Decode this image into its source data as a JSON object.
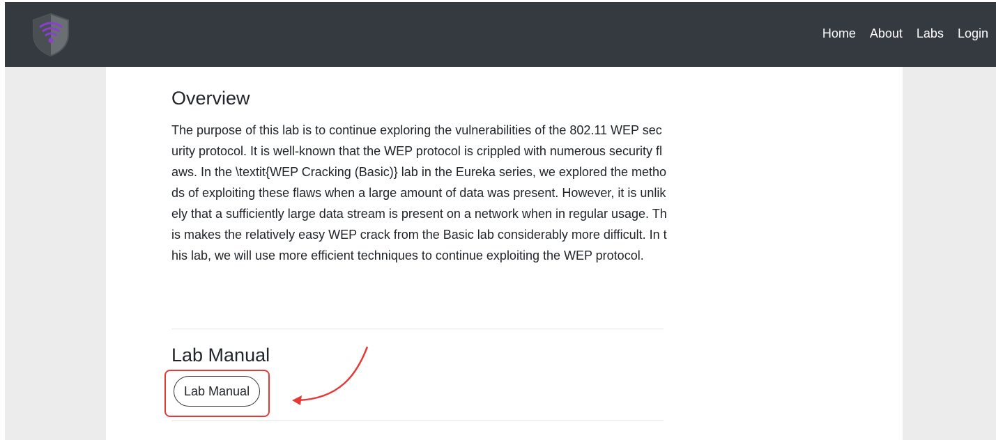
{
  "navbar": {
    "links": [
      {
        "label": "Home"
      },
      {
        "label": "About"
      },
      {
        "label": "Labs"
      },
      {
        "label": "Login"
      }
    ],
    "background": "#343a40"
  },
  "overview": {
    "title": "Overview",
    "body": "The purpose of this lab is to continue exploring the vulnerabilities of the 802.11 WEP security protocol. It is well-known that the WEP protocol is crippled with numerous security flaws. In the \\textit{WEP Cracking (Basic)} lab in the Eureka series, we explored the methods of exploiting these flaws when a large amount of data was present. However, it is unlikely that a sufficiently large data stream is present on a network when in regular usage. This makes the relatively easy WEP crack from the Basic lab considerably more difficult. In this lab, we will use more efficient techniques to continue exploiting the WEP protocol."
  },
  "lab_manual": {
    "title": "Lab Manual",
    "button_label": "Lab Manual"
  },
  "colors": {
    "annotation": "#e53935",
    "logo_purple": "#8a3fd1"
  }
}
